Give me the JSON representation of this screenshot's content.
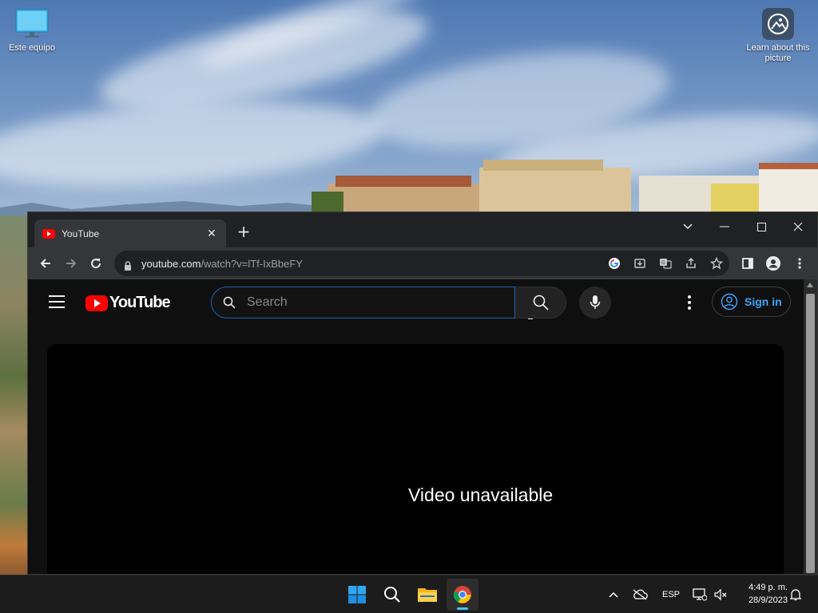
{
  "desktop": {
    "icons": [
      {
        "label": "Este equipo",
        "icon": "monitor-icon"
      },
      {
        "label": "Learn about this picture",
        "icon": "learn-picture-icon"
      }
    ]
  },
  "browser": {
    "tab": {
      "title": "YouTube",
      "favicon": "youtube-favicon-icon"
    },
    "address": {
      "host": "youtube.com",
      "path": "/watch?v=lTf-IxBbeFY"
    },
    "window_controls": [
      "tab-search",
      "minimize",
      "maximize",
      "close"
    ]
  },
  "youtube": {
    "logo_text": "YouTube",
    "search": {
      "placeholder": "Search",
      "value": ""
    },
    "signin_label": "Sign in",
    "player_message": "Video unavailable"
  },
  "taskbar": {
    "apps": [
      "start",
      "search",
      "file-explorer",
      "chrome"
    ],
    "active_app": "chrome",
    "language": "ESP",
    "time": "4:49 p. m.",
    "date": "28/9/2023"
  },
  "colors": {
    "accent_blue": "#3ea6ff",
    "youtube_red": "#ff0000",
    "search_focus_border": "#1c62b9",
    "taskbar_active": "#4cc2ff"
  }
}
